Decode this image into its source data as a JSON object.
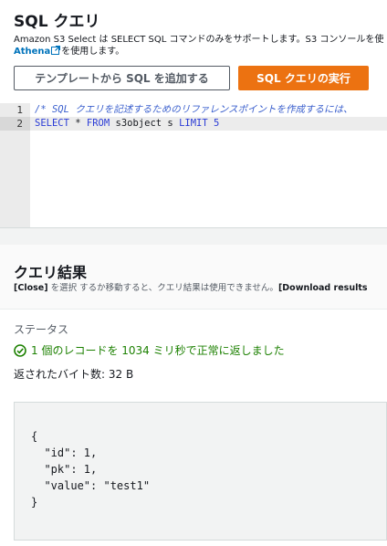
{
  "query_panel": {
    "title": "SQL クエリ",
    "description_line1": "Amazon S3 Select は SELECT SQL コマンドのみをサポートします。S3 コンソールを使",
    "description_link": "Athena",
    "description_line2_rest": "を使用します。",
    "add_template_button": "テンプレートから SQL を追加する",
    "run_query_button": "SQL クエリの実行"
  },
  "editor": {
    "lines": [
      {
        "number": "1",
        "text": "/* SQL クエリを記述するためのリファレンスポイントを作成するには、"
      },
      {
        "number": "2",
        "kw1": "SELECT",
        "t1": " * ",
        "kw2": "FROM",
        "t2": " s3object s ",
        "kw3": "LIMIT",
        "t3": " ",
        "num": "5"
      }
    ]
  },
  "results": {
    "title": "クエリ結果",
    "desc_close": "[Close]",
    "desc_middle": " を選択 するか移動すると、クエリ結果は使用できません。",
    "desc_download": "[Download results",
    "status_label": "ステータス",
    "status_message": "1 個のレコードを 1034 ミリ秒で正常に返しました",
    "bytes_returned": "返されたバイト数: 32 B",
    "output": "{\n  \"id\": 1,\n  \"pk\": 1,\n  \"value\": \"test1\"\n}"
  },
  "colors": {
    "primary_button": "#ec7211",
    "link": "#0073bb",
    "success": "#1d8102"
  },
  "icons": {
    "external_link": "external-link-icon",
    "status": "success-check-icon"
  }
}
